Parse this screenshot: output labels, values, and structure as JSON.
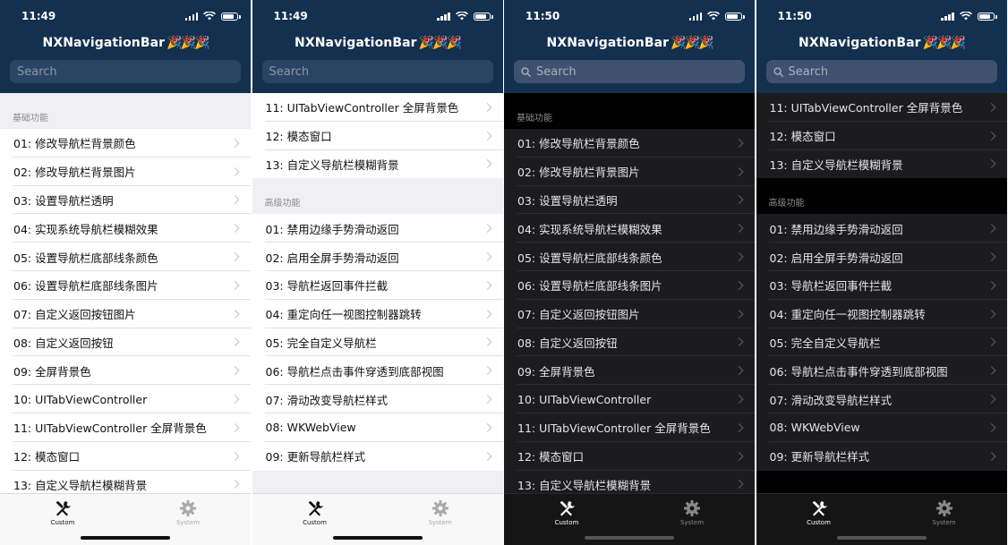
{
  "phones": [
    {
      "time": "11:49"
    },
    {
      "time": "11:49"
    },
    {
      "time": "11:50"
    },
    {
      "time": "11:50"
    }
  ],
  "nav": {
    "title": "NXNavigationBar",
    "title_emoji": "🎉🎉🎉",
    "search_placeholder": "Search"
  },
  "sections": {
    "basic": "基础功能",
    "advanced": "高级功能"
  },
  "basic_items": [
    "01: 修改导航栏背景颜色",
    "02: 修改导航栏背景图片",
    "03: 设置导航栏透明",
    "04: 实现系统导航栏模糊效果",
    "05: 设置导航栏底部线条颜色",
    "06: 设置导航栏底部线条图片",
    "07: 自定义返回按钮图片",
    "08: 自定义返回按钮",
    "09: 全屏背景色",
    "10: UITabViewController",
    "11: UITabViewController 全屏背景色",
    "12: 模态窗口",
    "13: 自定义导航栏模糊背景"
  ],
  "advanced_items": [
    "01: 禁用边缘手势滑动返回",
    "02: 启用全屏手势滑动返回",
    "03: 导航栏返回事件拦截",
    "04: 重定向任一视图控制器跳转",
    "05: 完全自定义导航栏",
    "06: 导航栏点击事件穿透到底部视图",
    "07: 滑动改变导航栏样式",
    "08: WKWebView",
    "09: 更新导航栏样式"
  ],
  "tabbar": {
    "custom_label": "Custom",
    "custom_icon": "tools-icon",
    "system_label": "System",
    "system_icon": "gear-icon"
  },
  "colors": {
    "nav_background": "#13304f",
    "light_list_background": "#efeff4",
    "dark_list_background": "#000000",
    "dark_cell_background": "#1c1c1e"
  }
}
